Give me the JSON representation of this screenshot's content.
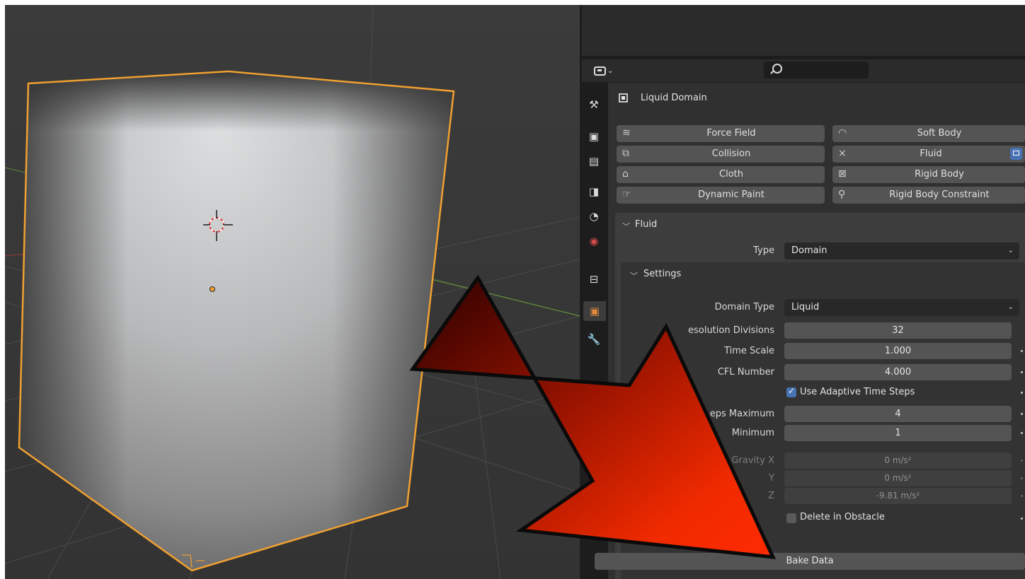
{
  "search": {
    "placeholder": ""
  },
  "object": {
    "name": "Liquid Domain"
  },
  "physics_buttons": {
    "force_field": "Force Field",
    "soft_body": "Soft Body",
    "collision": "Collision",
    "fluid": "Fluid",
    "cloth": "Cloth",
    "rigid_body": "Rigid Body",
    "dynamic_paint": "Dynamic Paint",
    "rigid_body_constraint": "Rigid Body Constraint",
    "fluid_remove_glyph": "×"
  },
  "fluid_panel": {
    "title": "Fluid",
    "type_label": "Type",
    "type_value": "Domain",
    "settings_title": "Settings",
    "domain_type_label": "Domain Type",
    "domain_type_value": "Liquid",
    "resolution_label": "esolution Divisions",
    "resolution_value": "32",
    "time_scale_label": "Time Scale",
    "time_scale_value": "1.000",
    "cfl_label": "CFL Number",
    "cfl_value": "4.000",
    "adaptive_label": "Use Adaptive Time Steps",
    "adaptive_checked": true,
    "steps_max_label": "eps Maximum",
    "steps_max_value": "4",
    "steps_min_label": "Minimum",
    "steps_min_value": "1",
    "gravity_x_label": "Gravity X",
    "gravity_x_value": "0 m/s²",
    "gravity_y_label": "Y",
    "gravity_y_value": "0 m/s²",
    "gravity_z_label": "Z",
    "gravity_z_value": "-9.81 m/s²",
    "delete_obstacle_label": "Delete in Obstacle",
    "delete_obstacle_checked": false,
    "bake_label": "Bake Data"
  },
  "colors": {
    "selection_outline": "#f0a030",
    "arrow_red": "#f02a00",
    "arrow_dark": "#2a0000",
    "active_blue": "#4772b3"
  },
  "icons": {
    "editor_type": "properties-editor-icon",
    "search": "search-icon",
    "tabs": [
      "tool-icon",
      "render-icon",
      "output-icon",
      "view-layer-icon",
      "scene-icon",
      "world-icon",
      "collection-icon",
      "object-icon",
      "modifier-icon"
    ]
  }
}
